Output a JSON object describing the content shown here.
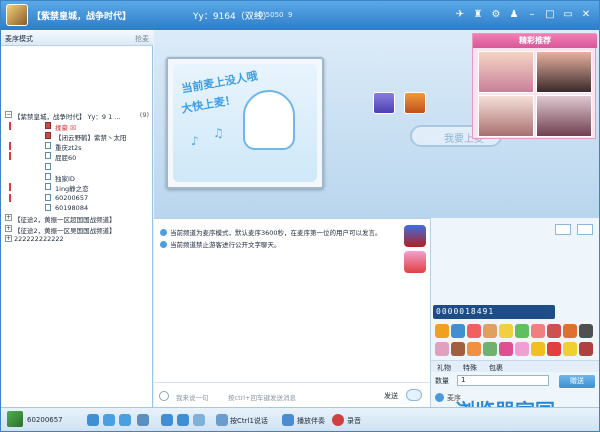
{
  "window": {
    "title": "【紫禁皇城，战争时代】",
    "channel_no": "Yy：9164（双线）",
    "id_label": "ID 5050",
    "online_count": "9"
  },
  "left_panel": {
    "mode_label": "麦序模式",
    "grab_label": "抢麦",
    "channels": [
      {
        "name": "【紫禁皇城，战争时代】 Yy：9 1 ...",
        "count": "(9)"
      },
      {
        "name": "【征途2，黄振一区超国国战频道】"
      },
      {
        "name": "【征途2，黄振一区吴国国战频道】"
      },
      {
        "name": "222222222222"
      }
    ],
    "members": [
      {
        "name": "揉豪 ☒"
      },
      {
        "name": "【闭云野鹤】紫禁丶太阳"
      },
      {
        "name": "重庆zt2s"
      },
      {
        "name": "屁屁60"
      },
      {
        "name": ""
      },
      {
        "name": "独家ID"
      },
      {
        "name": "1ing静之恋"
      },
      {
        "name": "60200657"
      },
      {
        "name": "60198084"
      }
    ]
  },
  "stage": {
    "mic_line1": "当前麦上没人哦",
    "mic_line2": "大快上麦！",
    "speak_label": "我要上麦",
    "recommend_title": "精彩推荐"
  },
  "chat": {
    "messages": [
      "当前频道为麦序模式，默认麦序3600秒，在麦序第一位的用户可以发言。",
      "当前频道禁止游客进行公开文字聊天。"
    ],
    "input_placeholder": "我来说一句",
    "input_hint": "按ctrl+回车键发送消息",
    "send_label": "发送"
  },
  "gift_panel": {
    "counter": "0000018491",
    "tabs": [
      "礼物",
      "特殊",
      "包裹"
    ],
    "qty_label": "数量",
    "qty_value": "1",
    "give_label": "赠送",
    "recipient_label": "麦序",
    "watermark": "浏览器家园"
  },
  "bottom_bar": {
    "user_id": "60200657",
    "ctrl_label": "按Ctrl1说话",
    "accompany_label": "播放伴奏",
    "record_label": "录音"
  },
  "colors": {
    "accent": "#2f7cc8",
    "red_marker": "#e23a3a",
    "recommend_pink": "#d8579a"
  }
}
